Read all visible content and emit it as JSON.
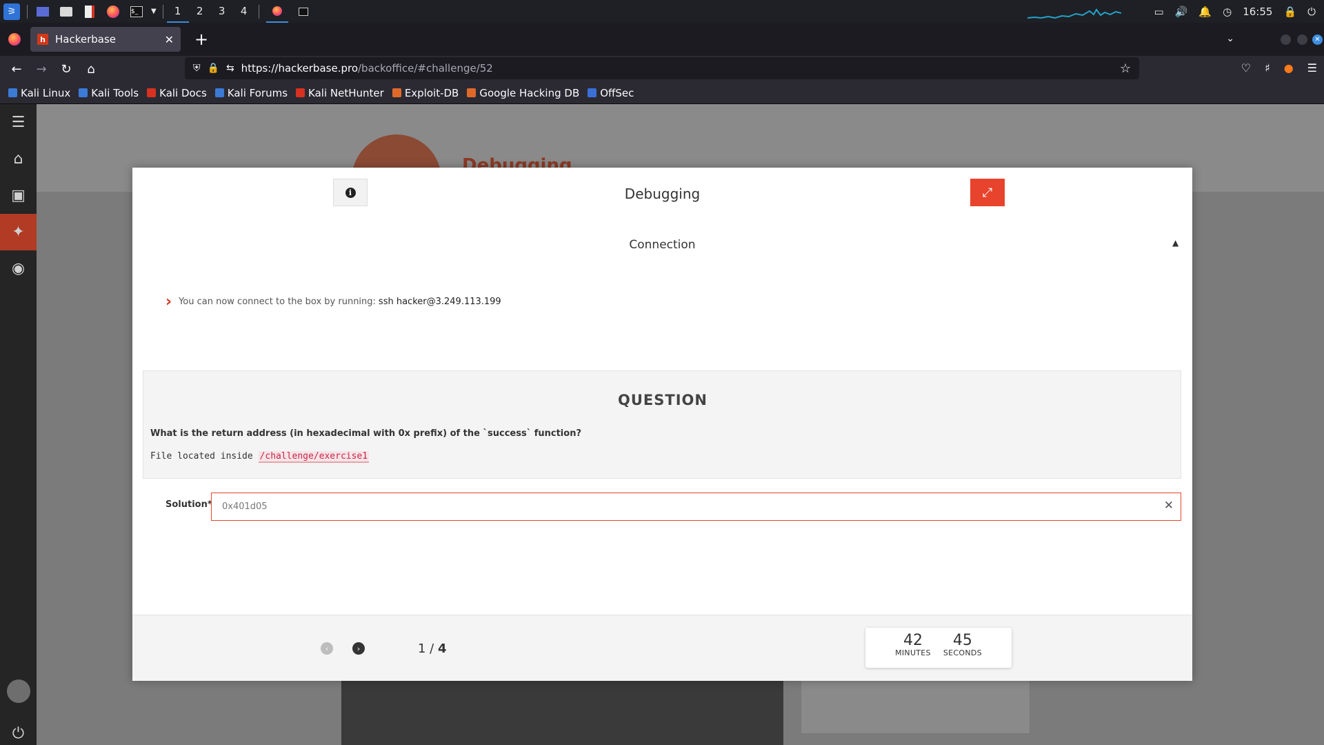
{
  "taskbar": {
    "workspaces": [
      "1",
      "2",
      "3",
      "4"
    ],
    "clock": "16:55"
  },
  "browser": {
    "tab_title": "Hackerbase",
    "tab_favicon": "h",
    "url_host": "https://hackerbase.pro",
    "url_path": "/backoffice/#challenge/52",
    "bookmarks": [
      "Kali Linux",
      "Kali Tools",
      "Kali Docs",
      "Kali Forums",
      "Kali NetHunter",
      "Exploit-DB",
      "Google Hacking DB",
      "OffSec"
    ],
    "bookmark_colors": [
      "#3b7bd6",
      "#3b7bd6",
      "#d6321f",
      "#3b7bd6",
      "#d6321f",
      "#e0692a",
      "#e0692a",
      "#3b6fd8"
    ]
  },
  "background_page": {
    "title": "Debugging"
  },
  "modal": {
    "title": "Debugging",
    "connection_label": "Connection",
    "connection_text": "You can now connect to the box by running:",
    "connection_cmd": "ssh hacker@3.249.113.199",
    "question_heading": "QUESTION",
    "question_text": "What is the return address (in hexadecimal with 0x prefix) of the `success` function?",
    "file_prefix": "File located inside",
    "file_path": "/challenge/exercise1",
    "solution_label": "Solution*",
    "solution_value": "0x401d05",
    "page_current": "1",
    "page_total": "4",
    "timer_minutes": "42",
    "timer_minutes_label": "MINUTES",
    "timer_seconds": "45",
    "timer_seconds_label": "SECONDS"
  },
  "colors": {
    "accent": "#e8432c",
    "sidebar_active": "#b13b24"
  }
}
